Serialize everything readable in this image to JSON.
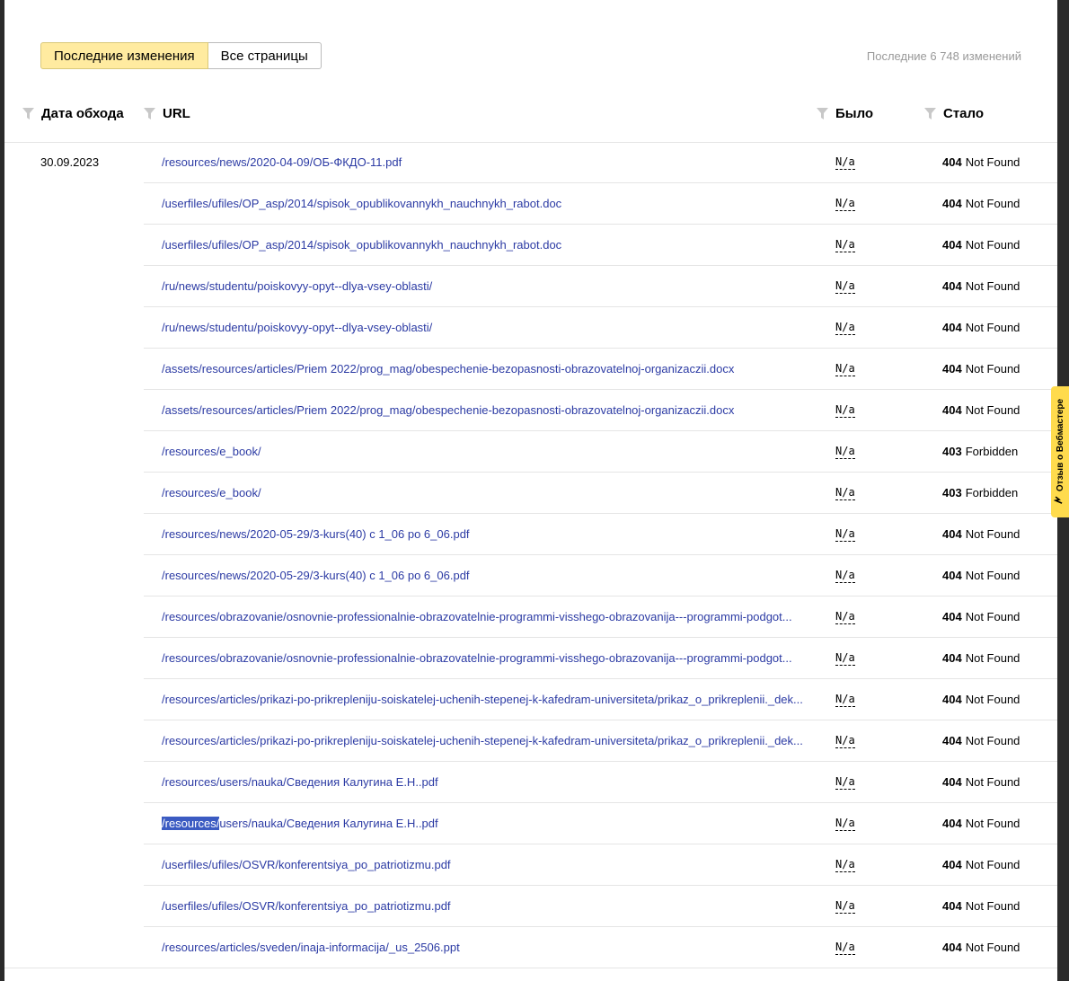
{
  "tabs": {
    "recent": "Последние изменения",
    "all": "Все страницы"
  },
  "total_label": "Последние 6 748 изменений",
  "columns": {
    "date": "Дата обхода",
    "url": "URL",
    "was": "Было",
    "now": "Стало"
  },
  "date": "30.09.2023",
  "rows": [
    {
      "url": "/resources/news/2020-04-09/ОБ-ФКДО-11.pdf",
      "was": "N/a",
      "code": "404",
      "status": "Not Found"
    },
    {
      "url": "/userfiles/ufiles/OP_asp/2014/spisok_opublikovannykh_nauchnykh_rabot.doc",
      "was": "N/a",
      "code": "404",
      "status": "Not Found"
    },
    {
      "url": "/userfiles/ufiles/OP_asp/2014/spisok_opublikovannykh_nauchnykh_rabot.doc",
      "was": "N/a",
      "code": "404",
      "status": "Not Found"
    },
    {
      "url": "/ru/news/studentu/poiskovyy-opyt--dlya-vsey-oblasti/",
      "was": "N/a",
      "code": "404",
      "status": "Not Found"
    },
    {
      "url": "/ru/news/studentu/poiskovyy-opyt--dlya-vsey-oblasti/",
      "was": "N/a",
      "code": "404",
      "status": "Not Found"
    },
    {
      "url": "/assets/resources/articles/Priem 2022/prog_mag/obespechenie-bezopasnosti-obrazovatelnoj-organizaczii.docx",
      "was": "N/a",
      "code": "404",
      "status": "Not Found"
    },
    {
      "url": "/assets/resources/articles/Priem 2022/prog_mag/obespechenie-bezopasnosti-obrazovatelnoj-organizaczii.docx",
      "was": "N/a",
      "code": "404",
      "status": "Not Found"
    },
    {
      "url": "/resources/e_book/",
      "was": "N/a",
      "code": "403",
      "status": "Forbidden"
    },
    {
      "url": "/resources/e_book/",
      "was": "N/a",
      "code": "403",
      "status": "Forbidden"
    },
    {
      "url": "/resources/news/2020-05-29/3-kurs(40) c 1_06 po 6_06.pdf",
      "was": "N/a",
      "code": "404",
      "status": "Not Found"
    },
    {
      "url": "/resources/news/2020-05-29/3-kurs(40) c 1_06 po 6_06.pdf",
      "was": "N/a",
      "code": "404",
      "status": "Not Found"
    },
    {
      "url": "/resources/obrazovanie/osnovnie-professionalnie-obrazovatelnie-programmi-visshego-obrazovanija---programmi-podgot...",
      "was": "N/a",
      "code": "404",
      "status": "Not Found"
    },
    {
      "url": "/resources/obrazovanie/osnovnie-professionalnie-obrazovatelnie-programmi-visshego-obrazovanija---programmi-podgot...",
      "was": "N/a",
      "code": "404",
      "status": "Not Found"
    },
    {
      "url": "/resources/articles/prikazi-po-prikrepleniju-soiskatelej-uchenih-stepenej-k-kafedram-universiteta/prikaz_o_prikreplenii._dek...",
      "was": "N/a",
      "code": "404",
      "status": "Not Found"
    },
    {
      "url": "/resources/articles/prikazi-po-prikrepleniju-soiskatelej-uchenih-stepenej-k-kafedram-universiteta/prikaz_o_prikreplenii._dek...",
      "was": "N/a",
      "code": "404",
      "status": "Not Found"
    },
    {
      "url": "/resources/users/nauka/Сведения Калугина Е.Н..pdf",
      "was": "N/a",
      "code": "404",
      "status": "Not Found"
    },
    {
      "url_selected": "/resources/",
      "url_rest": "users/nauka/Сведения Калугина Е.Н..pdf",
      "was": "N/a",
      "code": "404",
      "status": "Not Found"
    },
    {
      "url": "/userfiles/ufiles/OSVR/konferentsiya_po_patriotizmu.pdf",
      "was": "N/a",
      "code": "404",
      "status": "Not Found"
    },
    {
      "url": "/userfiles/ufiles/OSVR/konferentsiya_po_patriotizmu.pdf",
      "was": "N/a",
      "code": "404",
      "status": "Not Found"
    },
    {
      "url": "/resources/articles/sveden/inaja-informacija/_us_2506.ppt",
      "was": "N/a",
      "code": "404",
      "status": "Not Found"
    }
  ],
  "feedback_label": "Отзыв о Вебмастере",
  "colors": {
    "accent_tab": "#ffeba0",
    "link": "#2c3ba4",
    "feedback": "#ffdb4d",
    "selection": "#3b5bc2"
  }
}
